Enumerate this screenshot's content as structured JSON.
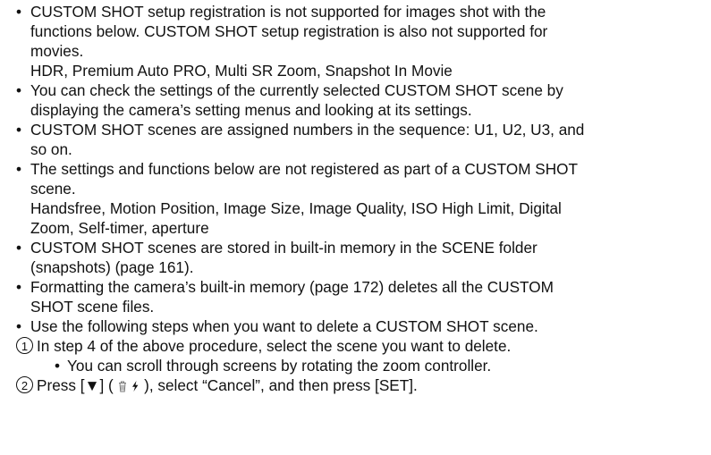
{
  "notes": [
    {
      "lines": [
        "CUSTOM SHOT setup registration is not supported for images shot with the",
        "functions below. CUSTOM SHOT setup registration is also not supported for",
        "movies.",
        "HDR, Premium Auto PRO, Multi SR Zoom, Snapshot In Movie"
      ]
    },
    {
      "lines": [
        "You can check the settings of the currently selected CUSTOM SHOT scene by",
        "displaying the camera’s setting menus and looking at its settings."
      ]
    },
    {
      "lines": [
        "CUSTOM SHOT scenes are assigned numbers in the sequence: U1, U2, U3, and",
        "so on."
      ]
    },
    {
      "lines": [
        "The settings and functions below are not registered as part of a CUSTOM SHOT",
        "scene.",
        "Handsfree, Motion Position, Image Size, Image Quality, ISO High Limit, Digital",
        "Zoom, Self-timer, aperture"
      ]
    },
    {
      "lines": [
        "CUSTOM SHOT scenes are stored in built-in memory in the SCENE folder",
        "(snapshots) (page 161)."
      ]
    },
    {
      "lines": [
        "Formatting the camera’s built-in memory (page 172) deletes all the CUSTOM",
        "SHOT scene files."
      ]
    },
    {
      "lines": [
        "Use the following steps when you want to delete a CUSTOM SHOT scene."
      ]
    }
  ],
  "steps": [
    {
      "number": "1",
      "text": "In step 4 of the above procedure, select the scene you want to delete.",
      "sub": "You can scroll through screens by rotating the zoom controller."
    },
    {
      "number": "2",
      "text_a": "Press [▼] (",
      "text_b": "), select “Cancel”, and then press [SET].",
      "icons": [
        "trash-icon",
        "flash-icon"
      ]
    }
  ],
  "bullet_glyph": "•"
}
